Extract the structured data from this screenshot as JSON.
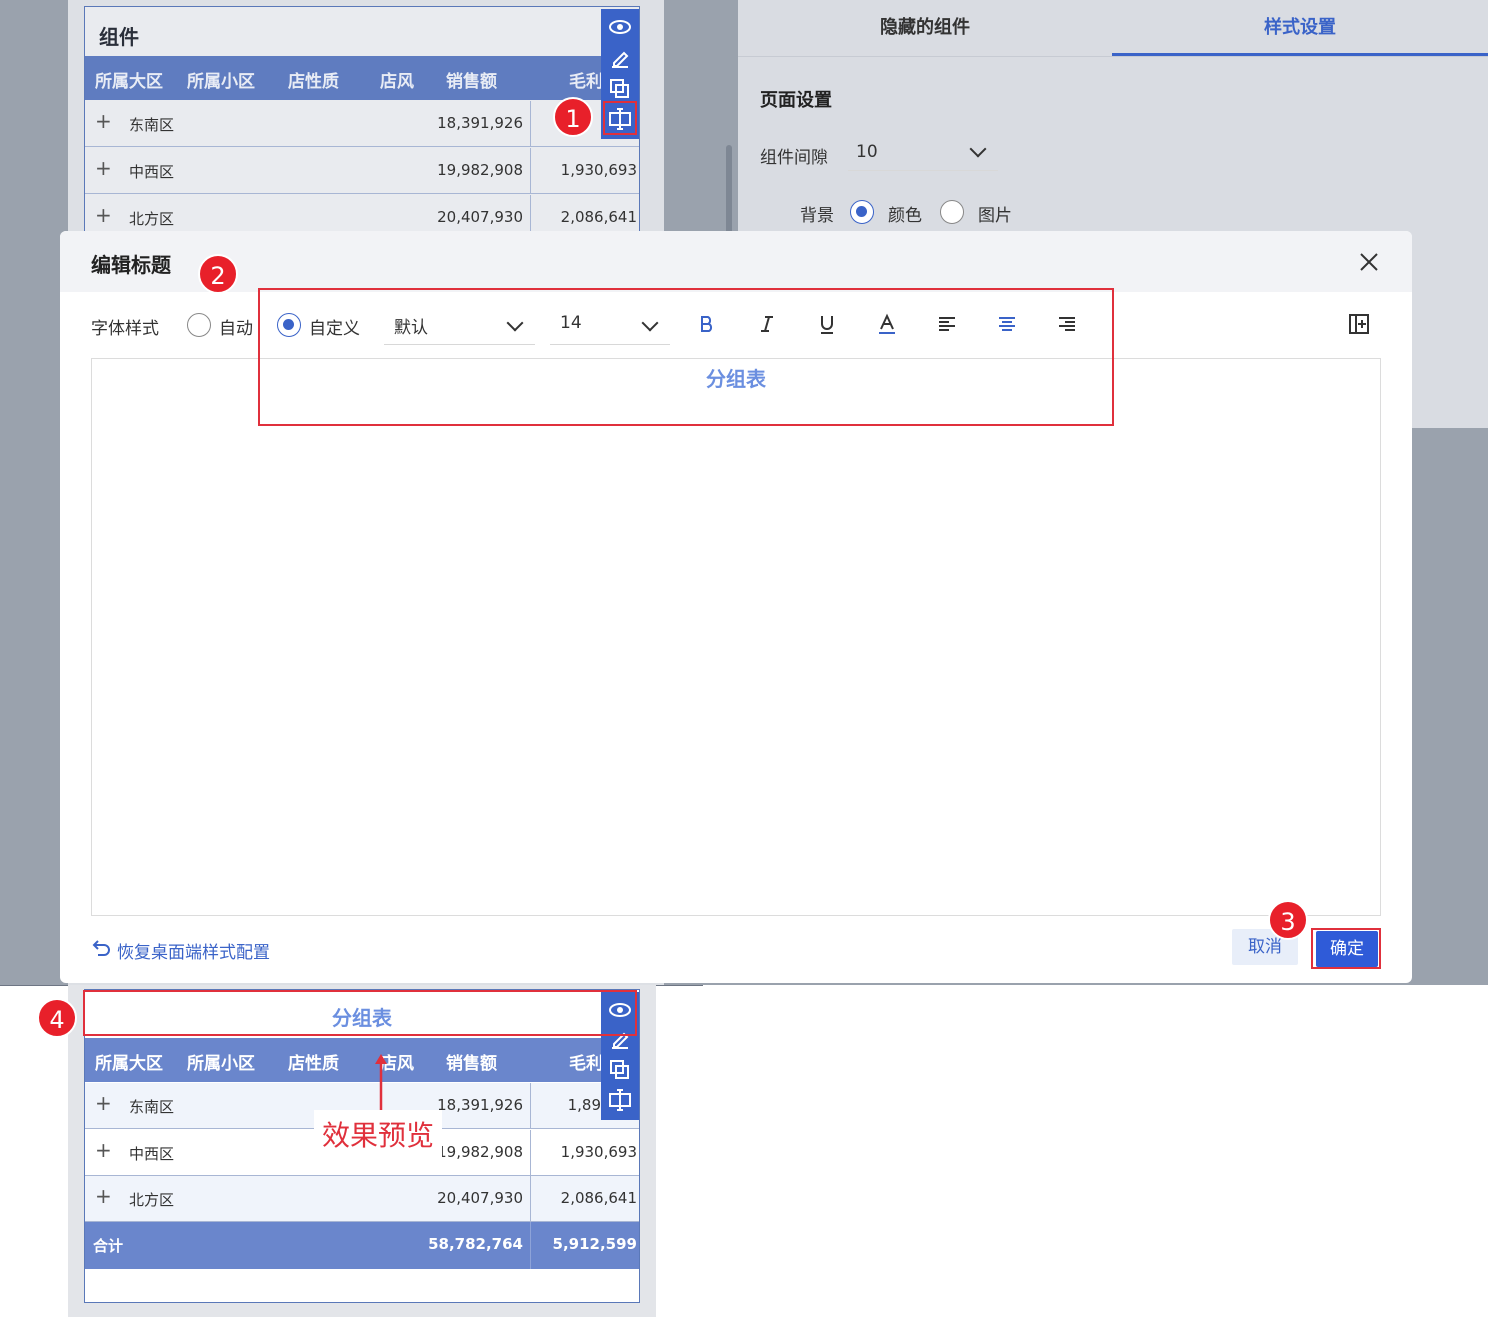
{
  "widget": {
    "title": "组件",
    "columns": [
      "所属大区",
      "所属小区",
      "店性质",
      "店风",
      "销售额",
      "毛利"
    ],
    "rows": [
      {
        "name": "东南区",
        "sales": "18,391,926",
        "profit": "1,89"
      },
      {
        "name": "中西区",
        "sales": "19,982,908",
        "profit": "1,930,693"
      },
      {
        "name": "北方区",
        "sales": "20,407,930",
        "profit": "2,086,641"
      }
    ],
    "total": {
      "label": "合计",
      "sales": "58,782,764",
      "profit": "5,912,599"
    }
  },
  "right_panel": {
    "tabs": [
      "隐藏的组件",
      "样式设置"
    ],
    "section_title": "页面设置",
    "gap_label": "组件间隙",
    "gap_value": "10",
    "bg_label": "背景",
    "bg_options": [
      "颜色",
      "图片"
    ]
  },
  "dialog": {
    "title": "编辑标题",
    "font_style_label": "字体样式",
    "auto_option": "自动",
    "custom_option": "自定义",
    "font_family": "默认",
    "font_size": "14",
    "title_text": "分组表",
    "restore_link": "恢复桌面端样式配置",
    "cancel_label": "取消",
    "ok_label": "确定"
  },
  "preview": {
    "title": "分组表",
    "annotation": "效果预览",
    "rows_sales": [
      "18,391,926",
      "19,982,908",
      "20,407,930"
    ],
    "rows_profit": [
      "1,89",
      "1,930,693",
      "2,086,641"
    ]
  },
  "badges": [
    "1",
    "2",
    "3",
    "4"
  ],
  "colors": {
    "accent": "#3a63c8",
    "title_blue": "#6b8fe0",
    "red": "#e0303c",
    "header": "#5f7cc0"
  }
}
